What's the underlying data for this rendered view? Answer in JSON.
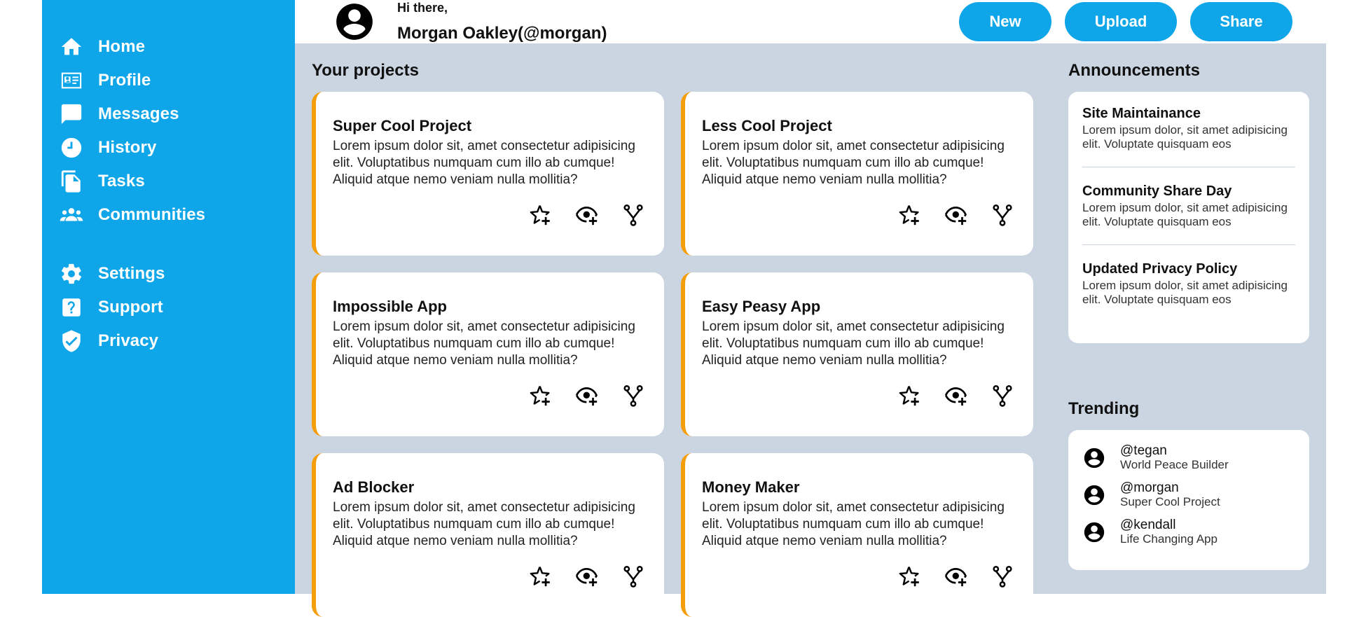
{
  "colors": {
    "primary": "#0ea5e9",
    "accent": "#f59e0b",
    "background": "#cbd5e1"
  },
  "sidebar": {
    "items": [
      {
        "label": "Home",
        "icon": "home-icon"
      },
      {
        "label": "Profile",
        "icon": "id-card-icon"
      },
      {
        "label": "Messages",
        "icon": "chat-icon"
      },
      {
        "label": "History",
        "icon": "clock-icon"
      },
      {
        "label": "Tasks",
        "icon": "documents-icon"
      },
      {
        "label": "Communities",
        "icon": "group-icon"
      }
    ],
    "secondary": [
      {
        "label": "Settings",
        "icon": "gear-icon"
      },
      {
        "label": "Support",
        "icon": "help-icon"
      },
      {
        "label": "Privacy",
        "icon": "shield-icon"
      }
    ]
  },
  "header": {
    "greeting": "Hi there,",
    "user": "Morgan Oakley(@morgan)",
    "buttons": {
      "new": "New",
      "upload": "Upload",
      "share": "Share"
    }
  },
  "projects": {
    "title": "Your projects",
    "items": [
      {
        "title": "Super Cool Project",
        "desc": "Lorem ipsum dolor sit, amet consectetur adipisicing elit. Voluptatibus numquam cum illo ab cumque! Aliquid atque nemo veniam nulla mollitia?"
      },
      {
        "title": "Less Cool Project",
        "desc": "Lorem ipsum dolor sit, amet consectetur adipisicing elit. Voluptatibus numquam cum illo ab cumque! Aliquid atque nemo veniam nulla mollitia?"
      },
      {
        "title": "Impossible App",
        "desc": "Lorem ipsum dolor sit, amet consectetur adipisicing elit. Voluptatibus numquam cum illo ab cumque! Aliquid atque nemo veniam nulla mollitia?"
      },
      {
        "title": "Easy Peasy App",
        "desc": "Lorem ipsum dolor sit, amet consectetur adipisicing elit. Voluptatibus numquam cum illo ab cumque! Aliquid atque nemo veniam nulla mollitia?"
      },
      {
        "title": "Ad Blocker",
        "desc": "Lorem ipsum dolor sit, amet consectetur adipisicing elit. Voluptatibus numquam cum illo ab cumque! Aliquid atque nemo veniam nulla mollitia?"
      },
      {
        "title": "Money Maker",
        "desc": "Lorem ipsum dolor sit, amet consectetur adipisicing elit. Voluptatibus numquam cum illo ab cumque! Aliquid atque nemo veniam nulla mollitia?"
      }
    ]
  },
  "announcements": {
    "title": "Announcements",
    "items": [
      {
        "title": "Site Maintainance",
        "desc": "Lorem ipsum dolor, sit amet adipisicing elit. Voluptate quisquam eos"
      },
      {
        "title": "Community Share Day",
        "desc": "Lorem ipsum dolor, sit amet adipisicing elit. Voluptate quisquam eos"
      },
      {
        "title": "Updated Privacy Policy",
        "desc": "Lorem ipsum dolor, sit amet adipisicing elit. Voluptate quisquam eos"
      }
    ]
  },
  "trending": {
    "title": "Trending",
    "items": [
      {
        "handle": "@tegan",
        "sub": "World Peace Builder"
      },
      {
        "handle": "@morgan",
        "sub": "Super Cool Project"
      },
      {
        "handle": "@kendall",
        "sub": "Life Changing App"
      }
    ]
  }
}
